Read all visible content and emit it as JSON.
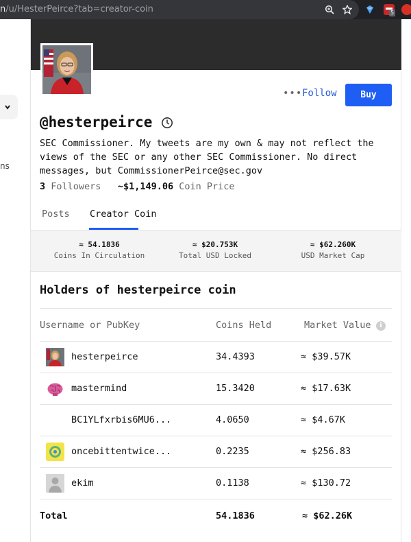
{
  "browser": {
    "url_domain_fragment": "n",
    "url_path": "/u/HesterPeirce?tab=creator-coin",
    "ext_badge": "5"
  },
  "icons": {
    "zoom": "zoom-icon",
    "bookmark": "star-icon",
    "ext1": "gem-icon",
    "ext2": "extension-icon",
    "ext3": "extension-icon",
    "timer": "clock-icon",
    "info": "info-icon",
    "more": "more-dots-icon",
    "chevron": "chevron-down-icon"
  },
  "sidebar": {
    "fragment_text": "ns"
  },
  "profile": {
    "more_label": "•••",
    "follow_label": "Follow",
    "buy_label": "Buy",
    "handle": "@hesterpeirce",
    "bio": "SEC Commissioner. My tweets are my own & may not reflect the views of the SEC or any other SEC Commissioner. No direct messages, but CommissionerPeirce@sec.gov",
    "followers_count": "3",
    "followers_label": "Followers",
    "coin_price": "~$1,149.06",
    "coin_price_label": "Coin Price"
  },
  "tabs": {
    "posts": "Posts",
    "creator_coin": "Creator Coin",
    "active": "Creator Coin"
  },
  "summary": {
    "coins_in_circulation": "≈ 54.1836",
    "coins_in_circulation_label": "Coins In Circulation",
    "total_usd_locked": "≈ $20.753K",
    "total_usd_locked_label": "Total USD Locked",
    "usd_market_cap": "≈ $62.260K",
    "usd_market_cap_label": "USD Market Cap"
  },
  "holders": {
    "title": "Holders of hesterpeirce coin",
    "columns": [
      "Username or PubKey",
      "Coins Held",
      "Market Value"
    ],
    "rows": [
      {
        "name": "hesterpeirce",
        "coins": "34.4393",
        "value": "≈ $39.57K"
      },
      {
        "name": "mastermind",
        "coins": "15.3420",
        "value": "≈ $17.63K"
      },
      {
        "name": "BC1YLfxrbis6MU6...",
        "coins": "4.0650",
        "value": "≈ $4.67K"
      },
      {
        "name": "oncebittentwice...",
        "coins": "0.2235",
        "value": "≈ $256.83"
      },
      {
        "name": "ekim",
        "coins": "0.1138",
        "value": "≈ $130.72"
      }
    ],
    "total_label": "Total",
    "total_coins": "54.1836",
    "total_value": "≈ $62.26K"
  },
  "colors": {
    "accent": "#1f5ef5",
    "follow_text": "#2559d6",
    "cover": "#2c2c2c"
  }
}
